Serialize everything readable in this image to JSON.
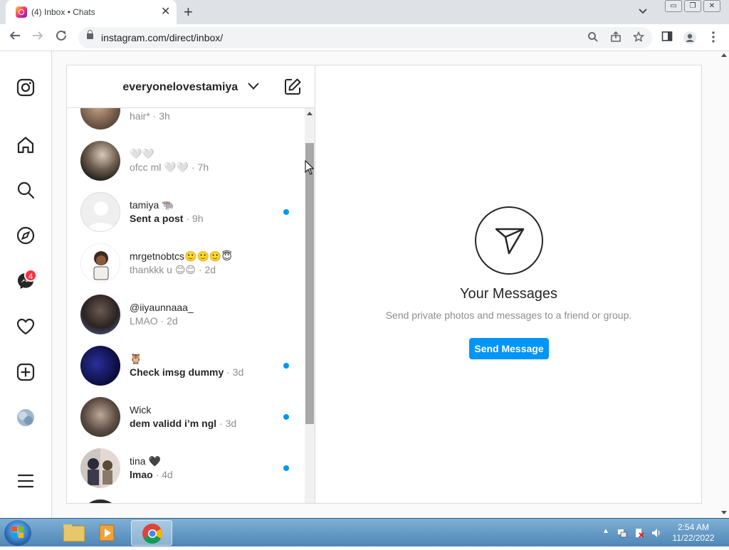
{
  "browser": {
    "tab_title": "(4) Inbox • Chats",
    "tab_close": "✕",
    "new_tab": "+",
    "url": "instagram.com/direct/inbox/",
    "window_buttons": [
      "▭",
      "❐",
      "✕"
    ]
  },
  "sidebar": {
    "icons": [
      "instagram-logo-icon",
      "home-icon",
      "search-icon",
      "explore-icon",
      "messenger-icon",
      "heart-icon",
      "create-icon",
      "profile-avatar",
      "menu-icon"
    ],
    "messenger_badge": "4"
  },
  "inbox": {
    "username": "everyonelovestamiya",
    "threads": [
      {
        "name": "",
        "message": "hair*",
        "time": " · 3h",
        "unread": false
      },
      {
        "name": "🤍🤍",
        "message": "ofcc ml 🤍🤍",
        "time": " · 7h",
        "unread": false
      },
      {
        "name": "tamiya 🐃",
        "message": "Sent a post",
        "time": " · 9h",
        "unread": true
      },
      {
        "name": "mrgetnobtcs🙂🙂🙂😇",
        "message": "thankkk u 😊😊",
        "time": " · 2d",
        "unread": false
      },
      {
        "name": "@iiyaunnaaa_",
        "message": "LMAO",
        "time": " · 2d",
        "unread": false
      },
      {
        "name": "🦉",
        "message": "Check imsg dummy",
        "time": " · 3d",
        "unread": true
      },
      {
        "name": "Wick",
        "message": "dem validd i’m ngl",
        "time": " · 3d",
        "unread": true
      },
      {
        "name": "tina 🖤",
        "message": "lmao",
        "time": " · 4d",
        "unread": true
      }
    ]
  },
  "empty_state": {
    "title": "Your Messages",
    "subtitle": "Send private photos and messages to a friend or group.",
    "button": "Send Message"
  },
  "taskbar": {
    "time": "2:54 AM",
    "date": "11/22/2022"
  },
  "colors": {
    "accent": "#0095f6",
    "badge": "#ff3040"
  }
}
